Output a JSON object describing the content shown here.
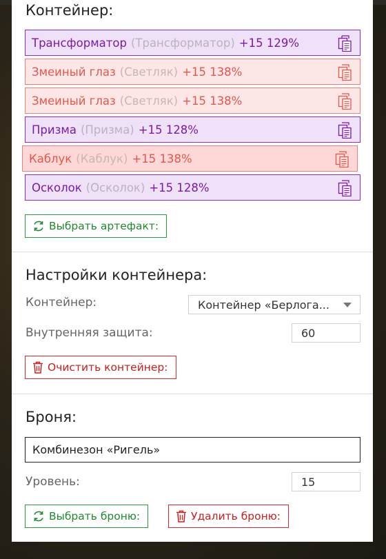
{
  "container": {
    "title": "Контейнер:",
    "artifacts": [
      {
        "name": "Трансформатор",
        "original": "(Трансформатор)",
        "bonus": "+15 129%",
        "tone": "purple"
      },
      {
        "name": "Змеиный глаз",
        "original": "(Светляк)",
        "bonus": "+15 138%",
        "tone": "red"
      },
      {
        "name": "Змеиный глаз",
        "original": "(Светляк)",
        "bonus": "+15 138%",
        "tone": "red"
      },
      {
        "name": "Призма",
        "original": "(Призма)",
        "bonus": "+15 128%",
        "tone": "purple"
      },
      {
        "name": "Каблук",
        "original": "(Каблук)",
        "bonus": "+15 138%",
        "tone": "red"
      },
      {
        "name": "Осколок",
        "original": "(Осколок)",
        "bonus": "+15 128%",
        "tone": "purple"
      }
    ],
    "select_artifact_label": "Выбрать артефакт:"
  },
  "settings": {
    "title": "Настройки контейнера:",
    "container_label": "Контейнер:",
    "container_value": "Контейнер «Берлога...",
    "protection_label": "Внутренняя защита:",
    "protection_value": "60",
    "clear_label": "Очистить контейнер:"
  },
  "armor": {
    "title": "Броня:",
    "name_value": "Комбинезон «Ригель»",
    "level_label": "Уровень:",
    "level_value": "15",
    "select_label": "Выбрать броню:",
    "delete_label": "Удалить броню:"
  },
  "colors": {
    "purple_text": "#7a1aa8",
    "red_text": "#e2584d",
    "green_button": "#1f8a2d",
    "red_button": "#c91e1e"
  }
}
